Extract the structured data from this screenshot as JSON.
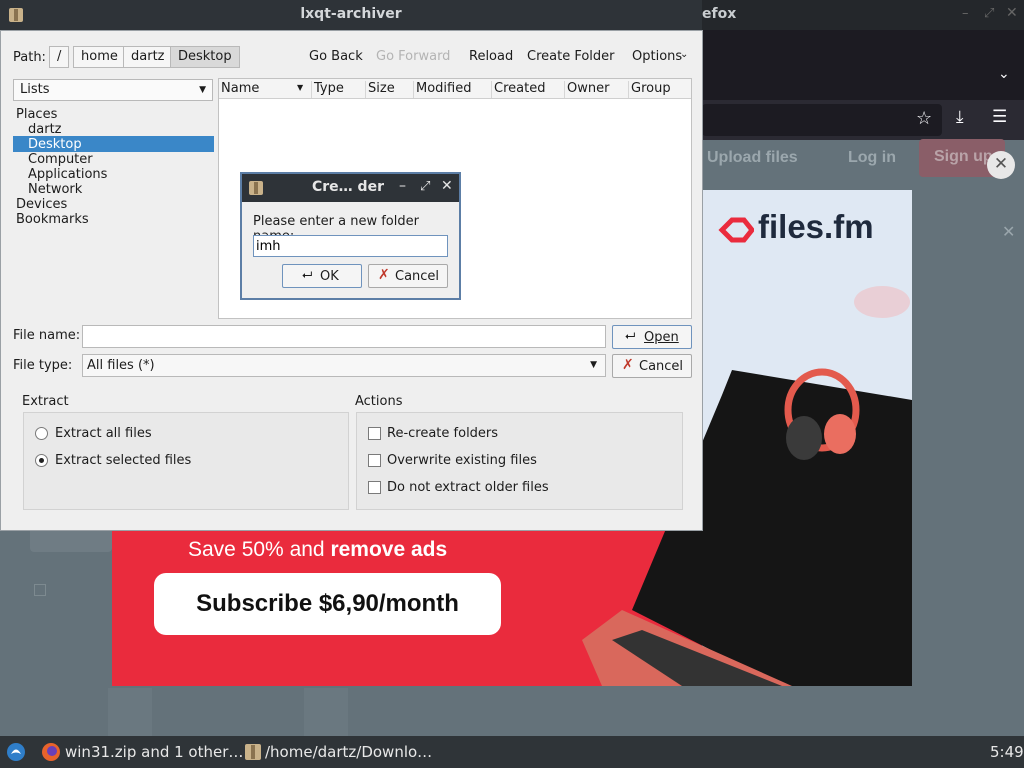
{
  "background_browser": {
    "title_fragment": "efox",
    "nav": {
      "upload": "Upload files",
      "login": "Log in",
      "signup": "Sign up"
    },
    "ad": {
      "logo": "files.fm",
      "save_prefix": "Save 50% and ",
      "save_bold": "remove ads",
      "subscribe": "Subscribe $6,90/month"
    }
  },
  "window": {
    "title": "lxqt-archiver"
  },
  "toolbar": {
    "path_label": "Path:",
    "path_segments": [
      "/",
      "home",
      "dartz",
      "Desktop"
    ],
    "go_back": "Go Back",
    "go_forward": "Go Forward",
    "reload": "Reload",
    "create_folder": "Create Folder",
    "options": "Options"
  },
  "side_panel": {
    "view_mode": "Lists",
    "places_header": "Places",
    "places": [
      "dartz",
      "Desktop",
      "Computer",
      "Applications",
      "Network"
    ],
    "devices": "Devices",
    "bookmarks": "Bookmarks"
  },
  "file_list": {
    "columns": [
      "Name",
      "Type",
      "Size",
      "Modified",
      "Created",
      "Owner",
      "Group"
    ]
  },
  "file_name": {
    "label": "File name:",
    "value": ""
  },
  "file_type": {
    "label": "File type:",
    "value": "All files (*)"
  },
  "buttons": {
    "open": "Open",
    "cancel": "Cancel"
  },
  "extract": {
    "title": "Extract",
    "options": [
      "Extract all files",
      "Extract selected files"
    ],
    "selected_index": 1
  },
  "actions": {
    "title": "Actions",
    "options": [
      "Re-create folders",
      "Overwrite existing files",
      "Do not extract older files"
    ]
  },
  "dialog": {
    "title": "Cre… der",
    "prompt": "Please enter a new folder name:",
    "value": "imh",
    "ok": "OK",
    "cancel": "Cancel"
  },
  "taskbar": {
    "tasks": [
      "win31.zip and 1 other…",
      "/home/dartz/Downlo…"
    ],
    "clock": "5:49"
  },
  "colors": {
    "selection": "#3a87c8",
    "ad_red": "#ea2b3d",
    "dialog_border": "#5c7ea6"
  }
}
